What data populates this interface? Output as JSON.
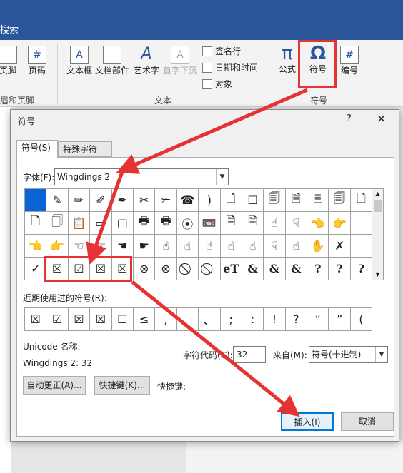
{
  "titlebar": {
    "search_text": "搜索"
  },
  "ribbon": {
    "buttons": [
      {
        "label": "页脚",
        "icon": "page-footer-icon"
      },
      {
        "label": "页码",
        "icon": "page-number-icon",
        "glyph": "#"
      },
      {
        "label": "文本框",
        "icon": "textbox-icon",
        "glyph": "A"
      },
      {
        "label": "文档部件",
        "icon": "quick-parts-icon"
      },
      {
        "label": "艺术字",
        "icon": "wordart-icon",
        "glyph": "A"
      },
      {
        "label": "首字下沉",
        "icon": "drop-cap-icon",
        "glyph": "A"
      },
      {
        "label": "公式",
        "icon": "equation-icon",
        "glyph": "π"
      },
      {
        "label": "符号",
        "icon": "symbol-icon",
        "glyph": "Ω"
      },
      {
        "label": "编号",
        "icon": "number-icon",
        "glyph": "#"
      }
    ],
    "small_buttons": [
      "签名行",
      "日期和时间",
      "对象"
    ],
    "groups": [
      "眉和页脚",
      "文本",
      "符号"
    ]
  },
  "dialog": {
    "title": "符号",
    "help": "?",
    "close": "✕",
    "tabs": [
      "符号(S)",
      "特殊字符(P)"
    ],
    "font_label": "字体(F):",
    "font_value": "Wingdings 2",
    "symbol_grid": [
      [
        "",
        "✎",
        "✏",
        "✐",
        "✒",
        "✂",
        "✃",
        "☎",
        ")",
        "🗋",
        "☐",
        "🗐",
        "🗎",
        "🗏",
        "🗐",
        "🗋"
      ],
      [
        "🗋",
        "🗍",
        "📋",
        "▭",
        "▢",
        "🖶",
        "🖶",
        "⦿",
        "📼",
        "🖹",
        "🗎",
        "☝",
        "☟",
        "👈",
        "👉",
        ""
      ],
      [
        "👈",
        "👉",
        "☜",
        "☞",
        "☚",
        "☛",
        "☝",
        "☝",
        "☝",
        "☝",
        "☝",
        "☟",
        "☝",
        "✋",
        "✗",
        ""
      ],
      [
        "✓",
        "☒",
        "☑",
        "☒",
        "☒",
        "⊗",
        "⊗",
        "⃠",
        "⃠",
        "eT",
        "&",
        "&",
        "&",
        "?",
        "?",
        "?"
      ]
    ],
    "recent_label": "近期使用过的符号(R):",
    "recent_symbols": [
      "☒",
      "☑",
      "☒",
      "☒",
      "☐",
      "≤",
      ",",
      "。",
      "、",
      ";",
      ":",
      "!",
      "?",
      "“",
      "”",
      "("
    ],
    "unicode_name_label": "Unicode 名称:",
    "char_name": "Wingdings 2: 32",
    "char_code_label": "字符代码(C):",
    "char_code_value": "32",
    "from_label": "来自(M):",
    "from_value": "符号(十进制)",
    "autocorrect_button": "自动更正(A)...",
    "shortcut_button": "快捷键(K)...",
    "shortcut_label": "快捷键:",
    "insert_button": "插入(I)",
    "cancel_button": "取消"
  },
  "colors": {
    "accent": "#2b579a",
    "annotation": "#e53333",
    "selection": "#0a64d8"
  }
}
